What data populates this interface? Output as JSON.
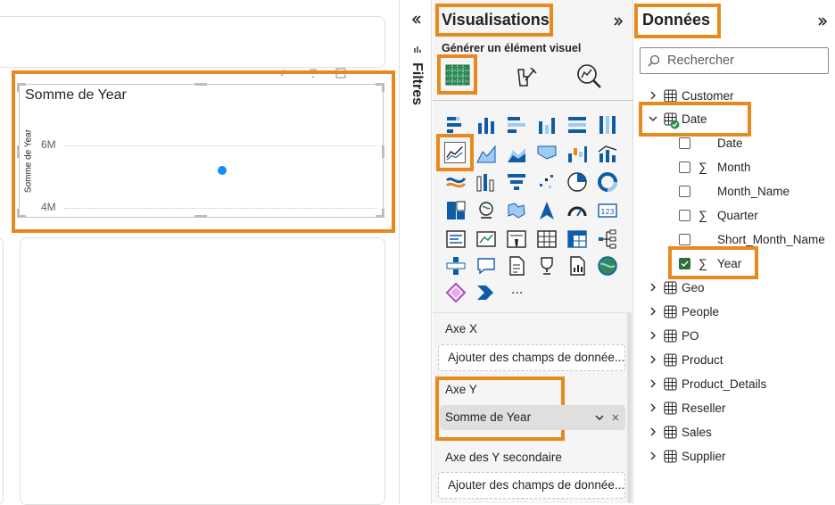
{
  "visual": {
    "title": "Somme de Year",
    "y_axis_title": "Somme de Year",
    "y_ticks": [
      "6M",
      "4M"
    ]
  },
  "filters": {
    "label": "Filtres"
  },
  "visualizations": {
    "title": "Visualisations",
    "build_label": "Générer un élément visuel",
    "more_label": "...",
    "wells": {
      "x_axis_label": "Axe X",
      "x_axis_placeholder": "Ajouter des champs de donnée...",
      "y_axis_label": "Axe Y",
      "y_axis_value": "Somme de Year",
      "y_secondary_label": "Axe des Y secondaire",
      "y_secondary_placeholder": "Ajouter des champs de donnée..."
    }
  },
  "data": {
    "title": "Données",
    "search_placeholder": "Rechercher",
    "tables": [
      "Customer",
      "Date",
      "Geo",
      "People",
      "PO",
      "Product",
      "Product_Details",
      "Reseller",
      "Sales",
      "Supplier"
    ],
    "date_fields": [
      "Date",
      "Month",
      "Month_Name",
      "Quarter",
      "Short_Month_Name",
      "Year"
    ]
  },
  "colors": {
    "highlight": "#e8891e",
    "accent": "#118dff"
  }
}
